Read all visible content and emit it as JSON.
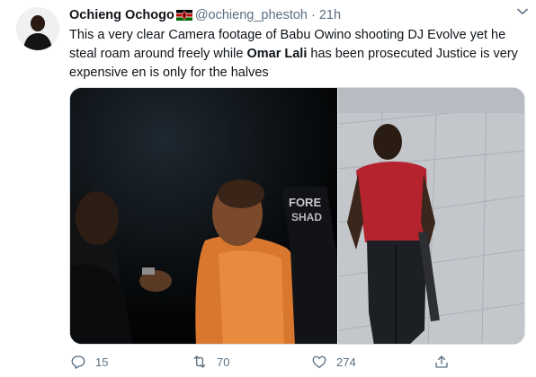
{
  "author": {
    "display_name": "Ochieng Ochogo",
    "flag_icon": "kenya-flag-icon",
    "handle": "@ochieng_phestoh",
    "separator": "·",
    "time": "21h"
  },
  "tweet": {
    "text_part1": "This a very clear Camera footage of Babu Owino shooting DJ Evolve yet he steal roam around freely while ",
    "text_bold": "Omar Lali",
    "text_part2": " has been prosecuted Justice is very expensive en is only for the halves"
  },
  "media": {
    "left_shirt_text_line1": "FORE",
    "left_shirt_text_line2": "SHAD"
  },
  "actions": {
    "reply_count": "15",
    "retweet_count": "70",
    "like_count": "274"
  },
  "colors": {
    "secondary_text": "#5b7083",
    "primary_text": "#0f1419",
    "flag_black": "#000000",
    "flag_red": "#bb0000",
    "flag_green": "#006600"
  }
}
